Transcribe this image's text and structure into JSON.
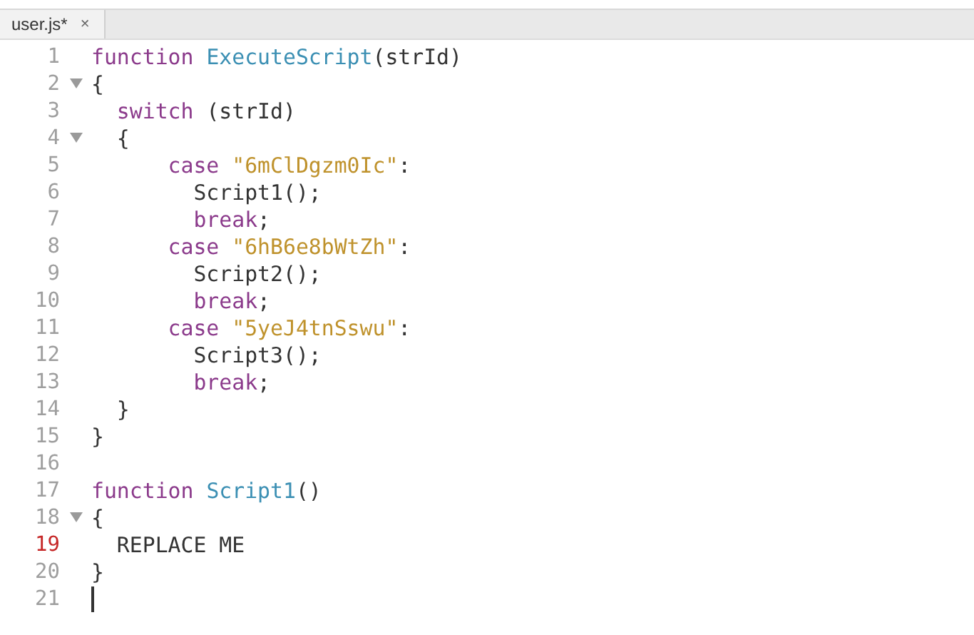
{
  "tabs": [
    {
      "label": "user.js*",
      "selected": true,
      "close": "×"
    }
  ],
  "editor": {
    "lines": [
      {
        "number": "1",
        "fold": false,
        "error": false,
        "tokens": [
          {
            "kind": "keyword",
            "text": "function "
          },
          {
            "kind": "name",
            "text": "ExecuteScript"
          },
          {
            "kind": "plain",
            "text": "(strId)"
          }
        ]
      },
      {
        "number": "2",
        "fold": true,
        "error": false,
        "tokens": [
          {
            "kind": "plain",
            "text": "{"
          }
        ]
      },
      {
        "number": "3",
        "fold": false,
        "error": false,
        "tokens": [
          {
            "kind": "keyword",
            "text": "  switch"
          },
          {
            "kind": "plain",
            "text": " (strId)"
          }
        ]
      },
      {
        "number": "4",
        "fold": true,
        "error": false,
        "tokens": [
          {
            "kind": "plain",
            "text": "  {"
          }
        ]
      },
      {
        "number": "5",
        "fold": false,
        "error": false,
        "tokens": [
          {
            "kind": "keyword",
            "text": "      case "
          },
          {
            "kind": "string",
            "text": "\"6mClDgzm0Ic\""
          },
          {
            "kind": "plain",
            "text": ":"
          }
        ]
      },
      {
        "number": "6",
        "fold": false,
        "error": false,
        "tokens": [
          {
            "kind": "plain",
            "text": "        Script1();"
          }
        ]
      },
      {
        "number": "7",
        "fold": false,
        "error": false,
        "tokens": [
          {
            "kind": "keyword",
            "text": "        break"
          },
          {
            "kind": "plain",
            "text": ";"
          }
        ]
      },
      {
        "number": "8",
        "fold": false,
        "error": false,
        "tokens": [
          {
            "kind": "keyword",
            "text": "      case "
          },
          {
            "kind": "string",
            "text": "\"6hB6e8bWtZh\""
          },
          {
            "kind": "plain",
            "text": ":"
          }
        ]
      },
      {
        "number": "9",
        "fold": false,
        "error": false,
        "tokens": [
          {
            "kind": "plain",
            "text": "        Script2();"
          }
        ]
      },
      {
        "number": "10",
        "fold": false,
        "error": false,
        "tokens": [
          {
            "kind": "keyword",
            "text": "        break"
          },
          {
            "kind": "plain",
            "text": ";"
          }
        ]
      },
      {
        "number": "11",
        "fold": false,
        "error": false,
        "tokens": [
          {
            "kind": "keyword",
            "text": "      case "
          },
          {
            "kind": "string",
            "text": "\"5yeJ4tnSswu\""
          },
          {
            "kind": "plain",
            "text": ":"
          }
        ]
      },
      {
        "number": "12",
        "fold": false,
        "error": false,
        "tokens": [
          {
            "kind": "plain",
            "text": "        Script3();"
          }
        ]
      },
      {
        "number": "13",
        "fold": false,
        "error": false,
        "tokens": [
          {
            "kind": "keyword",
            "text": "        break"
          },
          {
            "kind": "plain",
            "text": ";"
          }
        ]
      },
      {
        "number": "14",
        "fold": false,
        "error": false,
        "tokens": [
          {
            "kind": "plain",
            "text": "  }"
          }
        ]
      },
      {
        "number": "15",
        "fold": false,
        "error": false,
        "tokens": [
          {
            "kind": "plain",
            "text": "}"
          }
        ]
      },
      {
        "number": "16",
        "fold": false,
        "error": false
      },
      {
        "number": "17",
        "fold": false,
        "error": false,
        "tokens": [
          {
            "kind": "keyword",
            "text": "function "
          },
          {
            "kind": "name",
            "text": "Script1"
          },
          {
            "kind": "plain",
            "text": "()"
          }
        ]
      },
      {
        "number": "18",
        "fold": true,
        "error": false,
        "tokens": [
          {
            "kind": "plain",
            "text": "{"
          }
        ]
      },
      {
        "number": "19",
        "fold": false,
        "error": true,
        "tokens": [
          {
            "kind": "plain",
            "text": "  REPLACE ME"
          }
        ]
      },
      {
        "number": "20",
        "fold": false,
        "error": false,
        "tokens": [
          {
            "kind": "plain",
            "text": "}"
          }
        ]
      },
      {
        "number": "21",
        "fold": false,
        "error": false,
        "cursor": true
      }
    ]
  }
}
